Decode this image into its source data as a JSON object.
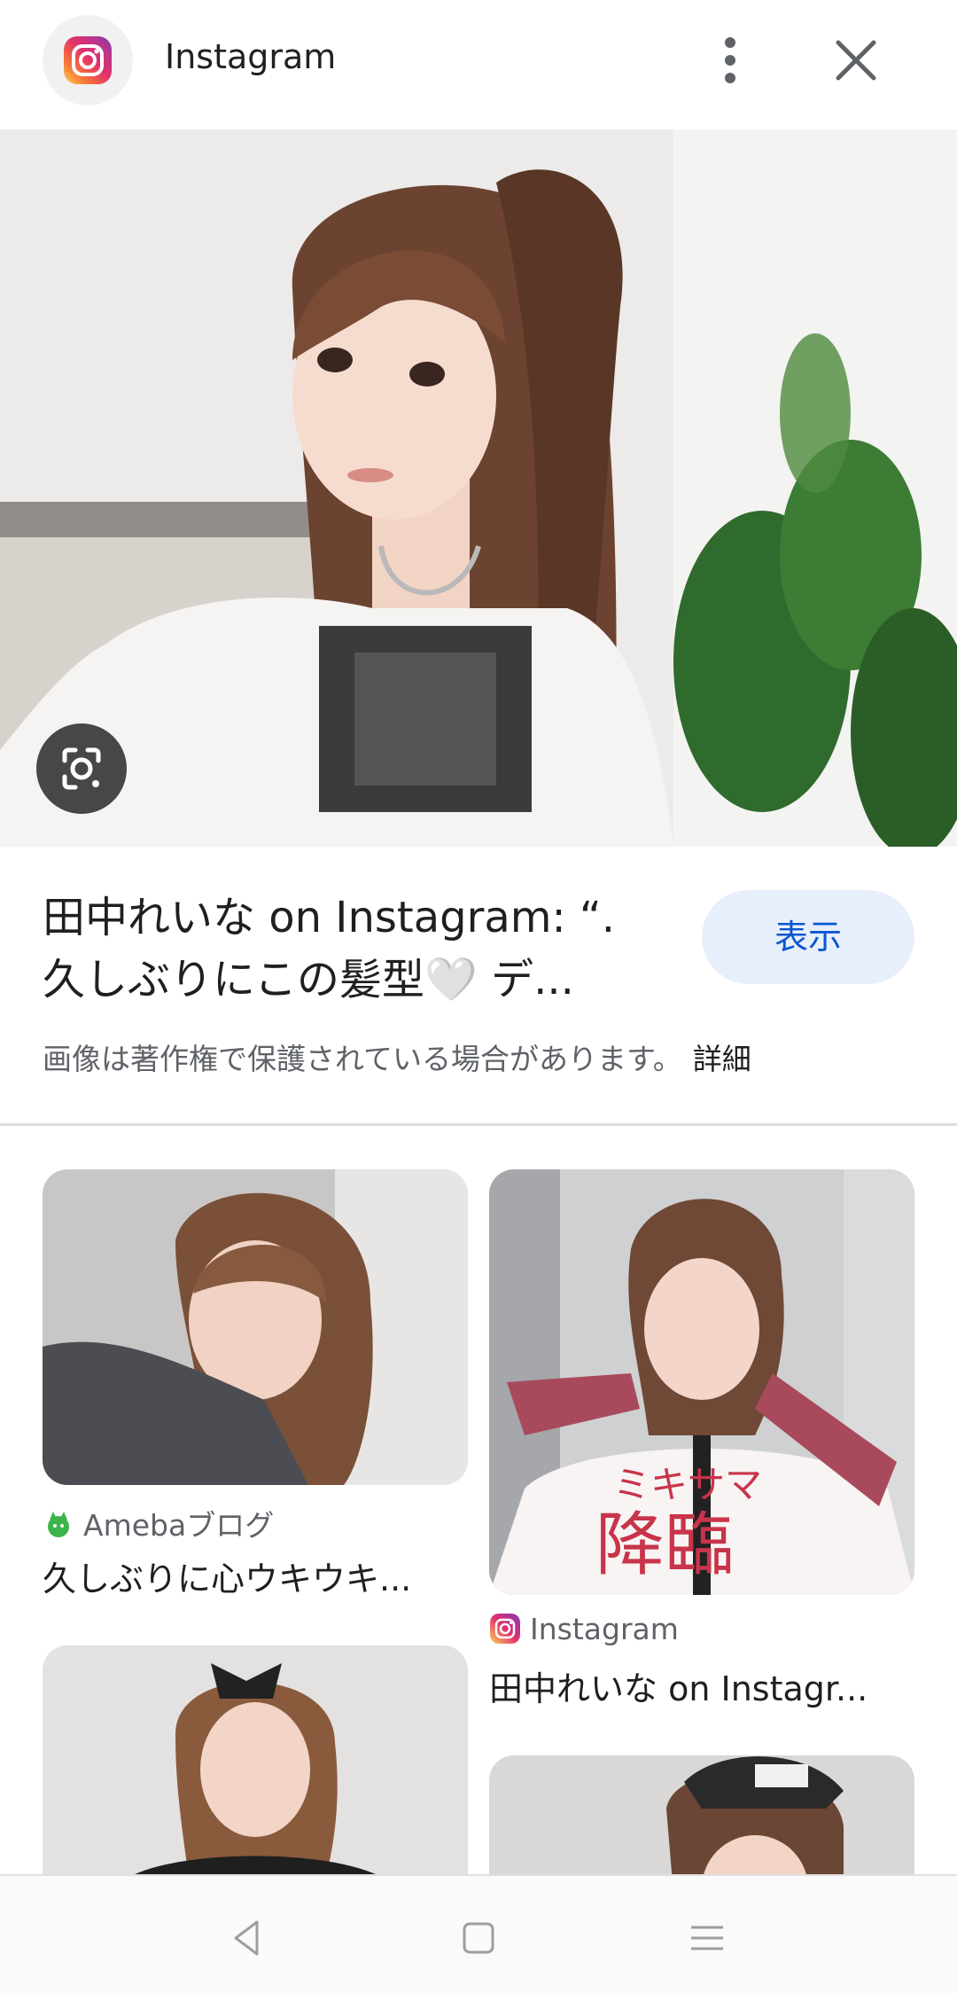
{
  "header": {
    "title": "Instagram",
    "logo_icon": "instagram-icon",
    "menu_icon": "more-vert-icon",
    "close_icon": "close-icon"
  },
  "hero": {
    "image_alt": "selfie photo",
    "lens_icon": "google-lens-icon"
  },
  "result": {
    "title_line1": "田中れいな on Instagram: “.",
    "title_line2": "久しぶりにこの髪型🤍 デ...",
    "view_button": "表示",
    "copyright_text": "画像は著作権で保護されている場合があります。",
    "more_link": "詳細"
  },
  "related": [
    {
      "source": "Amebaブログ",
      "title": "久しぶりに心ウキウキ...",
      "source_icon": "ameba-icon"
    },
    {
      "source": "Instagram",
      "title": "田中れいな on Instagr...",
      "source_icon": "instagram-icon"
    },
    {
      "source": "",
      "title": ""
    },
    {
      "source": "",
      "title": ""
    }
  ],
  "overlay_text": {
    "line1": "ミキサマ",
    "line2": "降臨"
  },
  "navbar": {
    "back_icon": "back-icon",
    "home_icon": "home-icon",
    "menu_icon": "menu-icon"
  },
  "colors": {
    "accent": "#0b57d0",
    "view_button_bg": "#e8effc"
  }
}
